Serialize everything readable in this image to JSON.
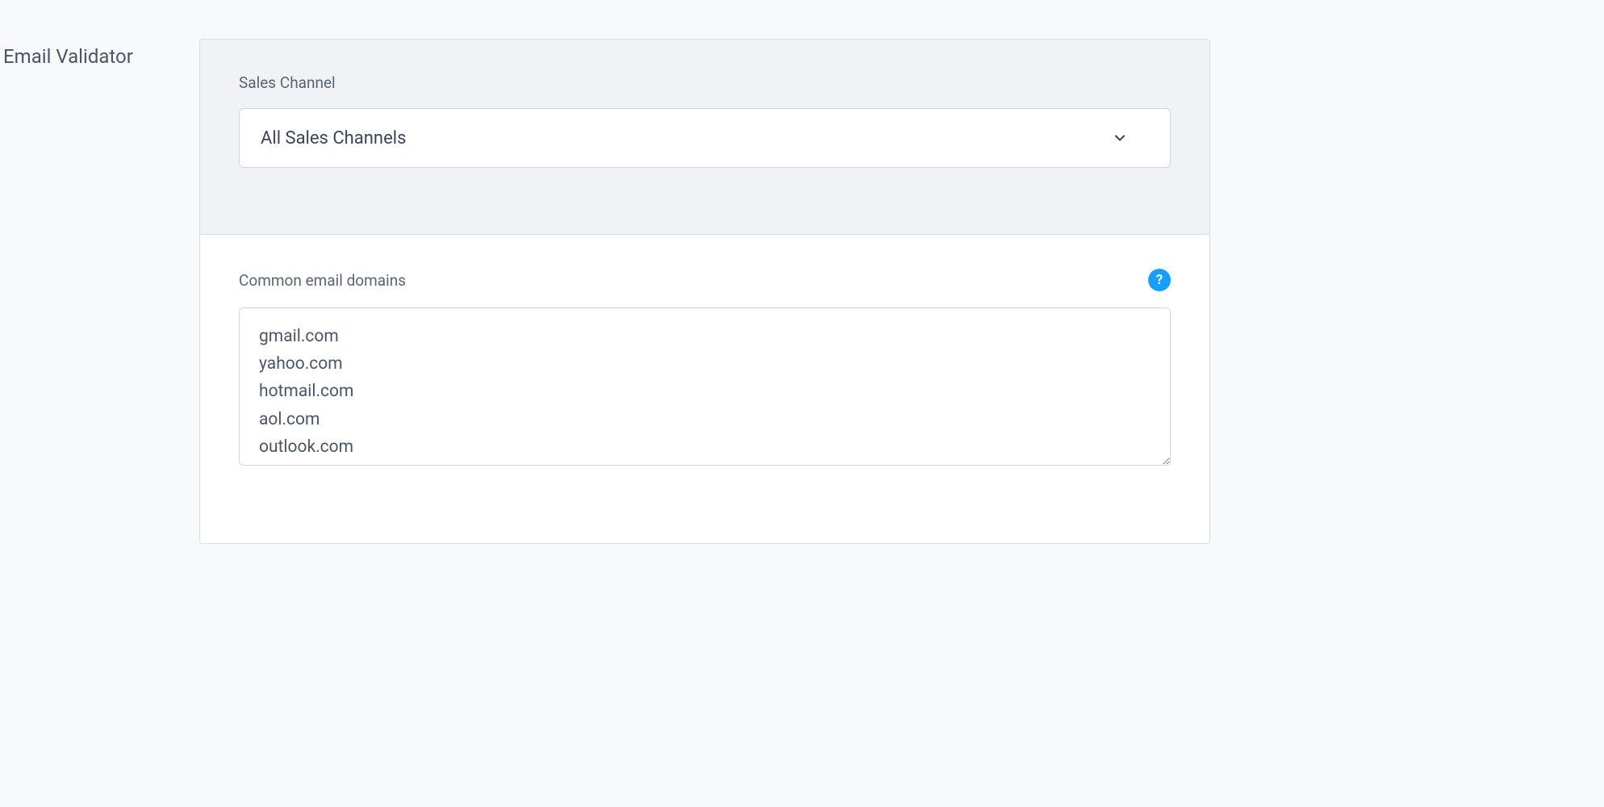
{
  "page": {
    "title": "Email Validator"
  },
  "salesChannel": {
    "label": "Sales Channel",
    "selected": "All Sales Channels"
  },
  "commonDomains": {
    "label": "Common email domains",
    "value": "gmail.com\nyahoo.com\nhotmail.com\naol.com\noutlook.com",
    "helpIcon": "?"
  }
}
